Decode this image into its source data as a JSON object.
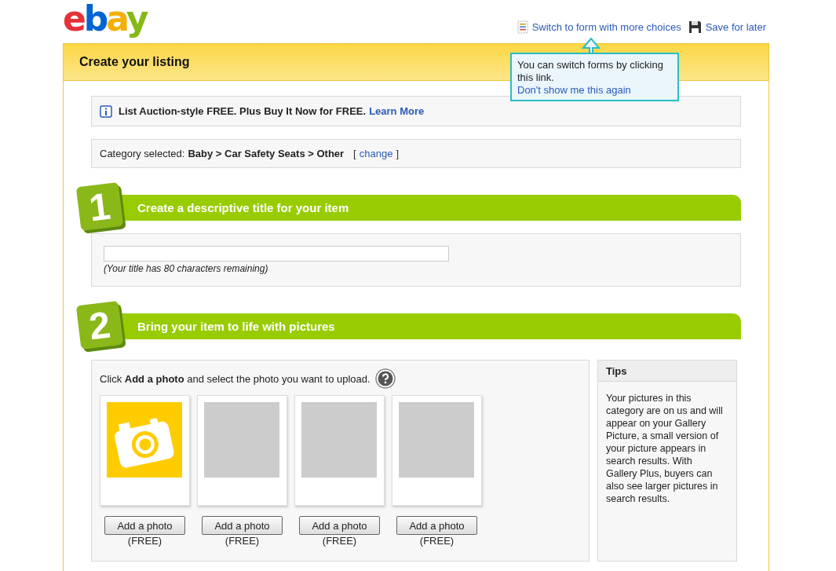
{
  "logo": "ebay",
  "top_links": [
    {
      "kind": "form",
      "label": "Switch to form with more choices"
    },
    {
      "kind": "save",
      "label": "Save for later"
    }
  ],
  "tooltip": {
    "text": "You can switch forms by clicking this link.",
    "link": "Don't show me this again"
  },
  "page_title": "Create your listing",
  "info": {
    "text": "List Auction-style FREE. Plus Buy It Now for FREE.",
    "link": "Learn More"
  },
  "category": {
    "label": "Category selected:",
    "path": "Baby > Car Safety Seats > Other",
    "open_bracket": "[",
    "change": "change",
    "close_bracket": "]"
  },
  "steps": [
    {
      "number": "1",
      "title": "Create a descriptive title for your item"
    },
    {
      "number": "2",
      "title": "Bring your item to life with pictures"
    }
  ],
  "title_field": {
    "hint": "(Your title has 80 characters remaining)"
  },
  "photos": {
    "instruction": "Click **Add a photo** and select the photo you want to upload.",
    "slots": [
      {
        "kind": "camera",
        "button": "Add a photo",
        "note": "(FREE)"
      },
      {
        "kind": "empty",
        "button": "Add a photo",
        "note": "(FREE)"
      },
      {
        "kind": "empty",
        "button": "Add a photo",
        "note": "(FREE)"
      },
      {
        "kind": "empty",
        "button": "Add a photo",
        "note": "(FREE)"
      }
    ]
  },
  "tips": {
    "title": "Tips",
    "text": "Your pictures in this category are on us and will appear on your Gallery Picture, a small version of your picture appears in search results. With Gallery Plus, buyers can also see larger pictures in search results."
  }
}
